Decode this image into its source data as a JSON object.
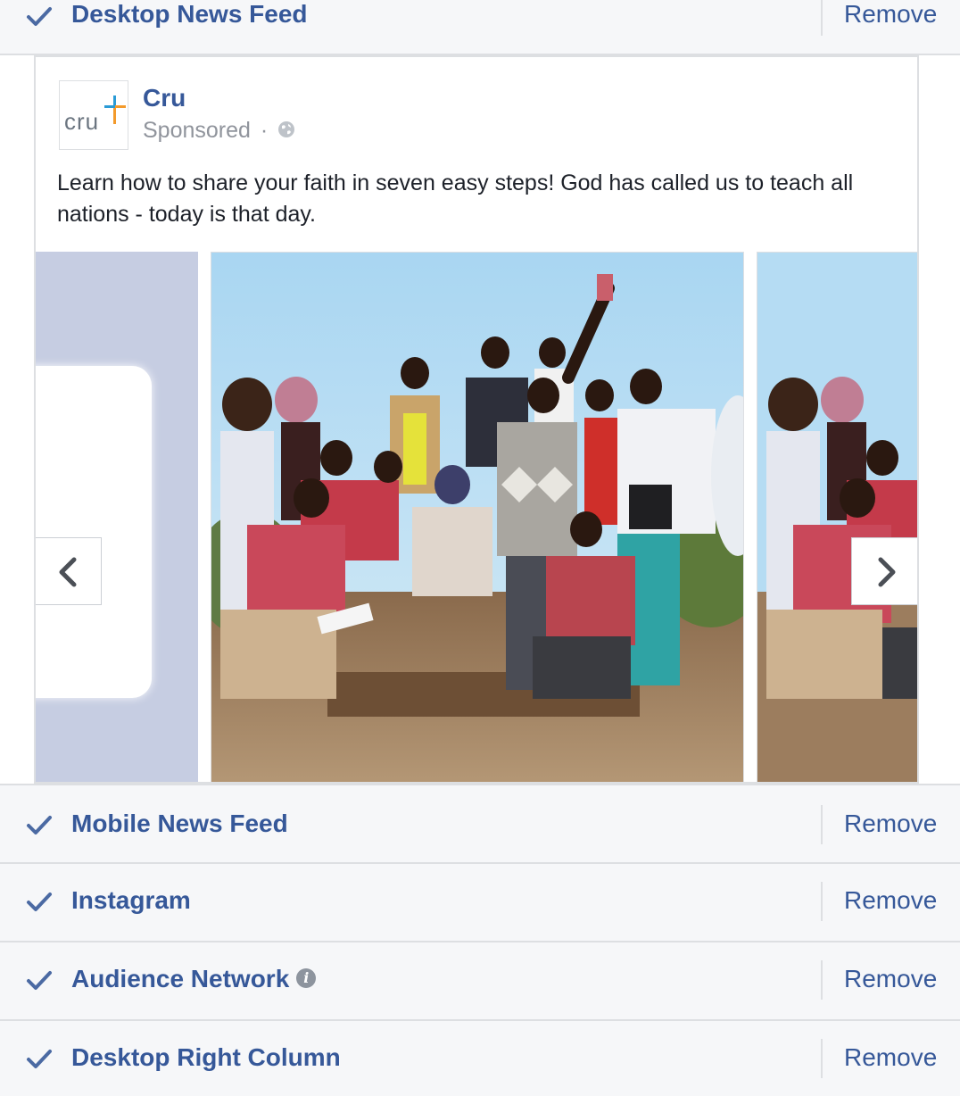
{
  "placements": [
    {
      "label": "Desktop News Feed",
      "remove": "Remove"
    },
    {
      "label": "Mobile News Feed",
      "remove": "Remove"
    },
    {
      "label": "Instagram",
      "remove": "Remove"
    },
    {
      "label": "Audience Network",
      "remove": "Remove"
    },
    {
      "label": "Desktop Right Column",
      "remove": "Remove"
    }
  ],
  "ad": {
    "page_name": "Cru",
    "logo_text": "cru",
    "sponsored": "Sponsored",
    "separator": "·",
    "text": "Learn how to share your faith in seven easy steps! God has called us to teach all nations - today is that day."
  },
  "icons": {
    "check": "check-icon",
    "info": "info-icon",
    "globe": "globe-icon",
    "prev": "chevron-left-icon",
    "next": "chevron-right-icon"
  },
  "colors": {
    "link_blue": "#365899",
    "row_bg": "#f6f7f9",
    "border": "#dddfe2",
    "muted": "#90949c",
    "body_text": "#1d2129",
    "carousel_prev_bg": "#c6cde2"
  }
}
